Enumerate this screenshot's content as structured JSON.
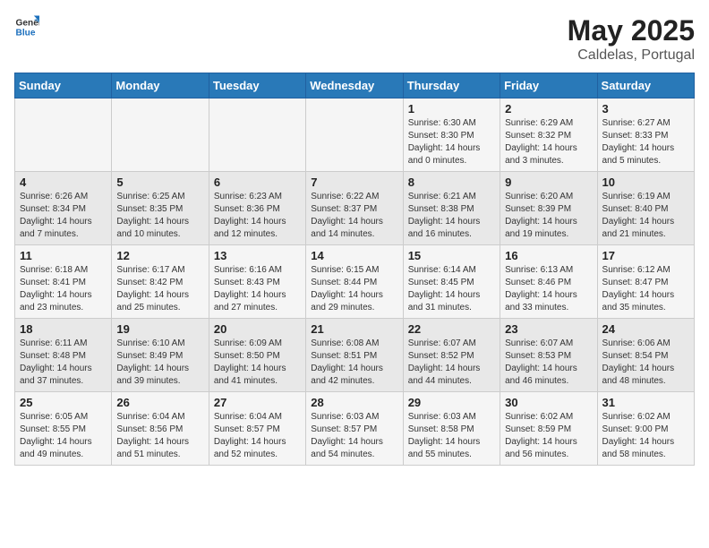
{
  "logo": {
    "general": "General",
    "blue": "Blue"
  },
  "title": {
    "month": "May 2025",
    "location": "Caldelas, Portugal"
  },
  "headers": [
    "Sunday",
    "Monday",
    "Tuesday",
    "Wednesday",
    "Thursday",
    "Friday",
    "Saturday"
  ],
  "weeks": [
    [
      {
        "day": "",
        "info": ""
      },
      {
        "day": "",
        "info": ""
      },
      {
        "day": "",
        "info": ""
      },
      {
        "day": "",
        "info": ""
      },
      {
        "day": "1",
        "info": "Sunrise: 6:30 AM\nSunset: 8:30 PM\nDaylight: 14 hours and 0 minutes."
      },
      {
        "day": "2",
        "info": "Sunrise: 6:29 AM\nSunset: 8:32 PM\nDaylight: 14 hours and 3 minutes."
      },
      {
        "day": "3",
        "info": "Sunrise: 6:27 AM\nSunset: 8:33 PM\nDaylight: 14 hours and 5 minutes."
      }
    ],
    [
      {
        "day": "4",
        "info": "Sunrise: 6:26 AM\nSunset: 8:34 PM\nDaylight: 14 hours and 7 minutes."
      },
      {
        "day": "5",
        "info": "Sunrise: 6:25 AM\nSunset: 8:35 PM\nDaylight: 14 hours and 10 minutes."
      },
      {
        "day": "6",
        "info": "Sunrise: 6:23 AM\nSunset: 8:36 PM\nDaylight: 14 hours and 12 minutes."
      },
      {
        "day": "7",
        "info": "Sunrise: 6:22 AM\nSunset: 8:37 PM\nDaylight: 14 hours and 14 minutes."
      },
      {
        "day": "8",
        "info": "Sunrise: 6:21 AM\nSunset: 8:38 PM\nDaylight: 14 hours and 16 minutes."
      },
      {
        "day": "9",
        "info": "Sunrise: 6:20 AM\nSunset: 8:39 PM\nDaylight: 14 hours and 19 minutes."
      },
      {
        "day": "10",
        "info": "Sunrise: 6:19 AM\nSunset: 8:40 PM\nDaylight: 14 hours and 21 minutes."
      }
    ],
    [
      {
        "day": "11",
        "info": "Sunrise: 6:18 AM\nSunset: 8:41 PM\nDaylight: 14 hours and 23 minutes."
      },
      {
        "day": "12",
        "info": "Sunrise: 6:17 AM\nSunset: 8:42 PM\nDaylight: 14 hours and 25 minutes."
      },
      {
        "day": "13",
        "info": "Sunrise: 6:16 AM\nSunset: 8:43 PM\nDaylight: 14 hours and 27 minutes."
      },
      {
        "day": "14",
        "info": "Sunrise: 6:15 AM\nSunset: 8:44 PM\nDaylight: 14 hours and 29 minutes."
      },
      {
        "day": "15",
        "info": "Sunrise: 6:14 AM\nSunset: 8:45 PM\nDaylight: 14 hours and 31 minutes."
      },
      {
        "day": "16",
        "info": "Sunrise: 6:13 AM\nSunset: 8:46 PM\nDaylight: 14 hours and 33 minutes."
      },
      {
        "day": "17",
        "info": "Sunrise: 6:12 AM\nSunset: 8:47 PM\nDaylight: 14 hours and 35 minutes."
      }
    ],
    [
      {
        "day": "18",
        "info": "Sunrise: 6:11 AM\nSunset: 8:48 PM\nDaylight: 14 hours and 37 minutes."
      },
      {
        "day": "19",
        "info": "Sunrise: 6:10 AM\nSunset: 8:49 PM\nDaylight: 14 hours and 39 minutes."
      },
      {
        "day": "20",
        "info": "Sunrise: 6:09 AM\nSunset: 8:50 PM\nDaylight: 14 hours and 41 minutes."
      },
      {
        "day": "21",
        "info": "Sunrise: 6:08 AM\nSunset: 8:51 PM\nDaylight: 14 hours and 42 minutes."
      },
      {
        "day": "22",
        "info": "Sunrise: 6:07 AM\nSunset: 8:52 PM\nDaylight: 14 hours and 44 minutes."
      },
      {
        "day": "23",
        "info": "Sunrise: 6:07 AM\nSunset: 8:53 PM\nDaylight: 14 hours and 46 minutes."
      },
      {
        "day": "24",
        "info": "Sunrise: 6:06 AM\nSunset: 8:54 PM\nDaylight: 14 hours and 48 minutes."
      }
    ],
    [
      {
        "day": "25",
        "info": "Sunrise: 6:05 AM\nSunset: 8:55 PM\nDaylight: 14 hours and 49 minutes."
      },
      {
        "day": "26",
        "info": "Sunrise: 6:04 AM\nSunset: 8:56 PM\nDaylight: 14 hours and 51 minutes."
      },
      {
        "day": "27",
        "info": "Sunrise: 6:04 AM\nSunset: 8:57 PM\nDaylight: 14 hours and 52 minutes."
      },
      {
        "day": "28",
        "info": "Sunrise: 6:03 AM\nSunset: 8:57 PM\nDaylight: 14 hours and 54 minutes."
      },
      {
        "day": "29",
        "info": "Sunrise: 6:03 AM\nSunset: 8:58 PM\nDaylight: 14 hours and 55 minutes."
      },
      {
        "day": "30",
        "info": "Sunrise: 6:02 AM\nSunset: 8:59 PM\nDaylight: 14 hours and 56 minutes."
      },
      {
        "day": "31",
        "info": "Sunrise: 6:02 AM\nSunset: 9:00 PM\nDaylight: 14 hours and 58 minutes."
      }
    ]
  ]
}
